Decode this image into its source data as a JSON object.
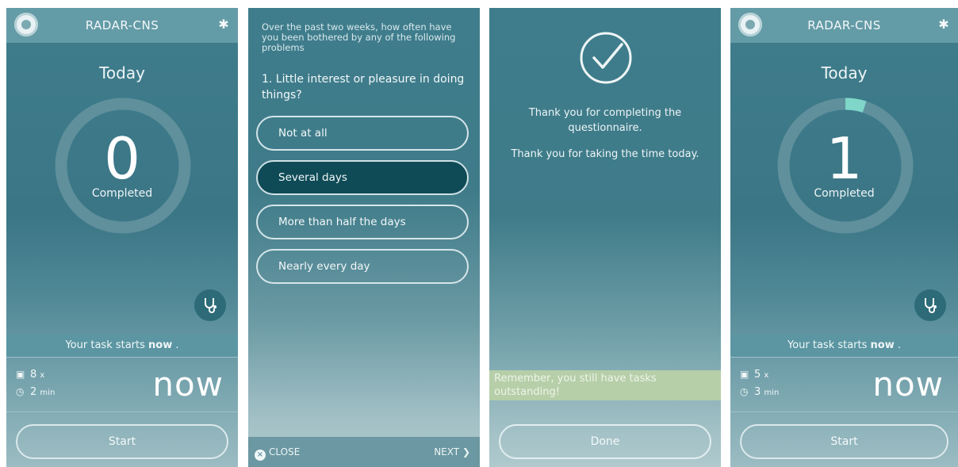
{
  "screens": [
    {
      "app_title": "RADAR-CNS",
      "today_label": "Today",
      "completed_count": "0",
      "completed_label": "Completed",
      "progress_fraction": 0,
      "task_prefix": "Your task starts ",
      "task_bold": "now",
      "task_suffix": " .",
      "questions_count": "8",
      "questions_unit": "x",
      "duration_value": "2",
      "duration_unit": "min",
      "starts_in": "now",
      "start_button": "Start"
    },
    {
      "intro": "Over the past two weeks, how often have you been bothered by any of the following problems",
      "question": "1. Little interest or pleasure in doing things?",
      "options": [
        "Not at all",
        "Several days",
        "More than half the days",
        "Nearly every day"
      ],
      "selected_index": 1,
      "close_label": "CLOSE",
      "next_label": "NEXT"
    },
    {
      "thanks_line1": "Thank you for completing the questionnaire.",
      "thanks_line2": "Thank you for taking the time today.",
      "reminder": "Remember, you still have tasks outstanding!",
      "done_button": "Done"
    },
    {
      "app_title": "RADAR-CNS",
      "today_label": "Today",
      "completed_count": "1",
      "completed_label": "Completed",
      "progress_fraction": 0.05,
      "task_prefix": "Your task starts ",
      "task_bold": "now",
      "task_suffix": " .",
      "questions_count": "5",
      "questions_unit": "x",
      "duration_value": "3",
      "duration_unit": "min",
      "starts_in": "now",
      "start_button": "Start"
    }
  ],
  "colors": {
    "accent": "#7fd6c9",
    "selected_option": "#0f4b57",
    "reminder_bg": "#b6cfa9"
  },
  "icons": [
    "app-logo-icon",
    "settings-gear-icon",
    "stethoscope-icon",
    "checklist-icon",
    "clock-icon",
    "close-circle-icon",
    "chevron-right-icon",
    "checkmark-circle-icon"
  ]
}
